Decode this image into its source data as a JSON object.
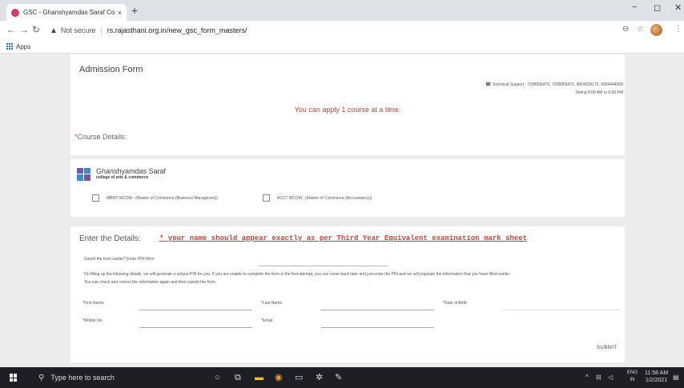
{
  "browser": {
    "tab_title": "GSC - Ghanshyamdas Saraf Colle",
    "tab_close": "×",
    "new_tab": "+",
    "win_minimize": "−",
    "win_restore": "◻",
    "win_close": "✕",
    "security": "Not secure",
    "url": "rs.rajasthani.org.in/new_gsc_form_masters/",
    "bookmark_apps": "Apps",
    "icons": [
      "back-icon",
      "forward-icon",
      "reload-icon",
      "warning-icon",
      "zoom-icon",
      "star-icon",
      "profile-avatar",
      "menu-icon"
    ]
  },
  "admission": {
    "title": "Admission Form",
    "support_line": "Technical Support : 7208955470, 7208955471, 9004028170, 9004444068",
    "timing": "Timing 8:00 AM to 6:00 PM",
    "apply_note": "You can apply 1 course at a time.",
    "course_label": "Course Details:",
    "required_mark": "*"
  },
  "college": {
    "name": "Ghanshyamdas Saraf",
    "subtitle": "college of arts & commerce",
    "courses": [
      {
        "label": "MBMT MCOM - (Master of Commerce (Business Managment))",
        "checked": false
      },
      {
        "label": "ACCT MCOM - (Master of Commerce (Accountancy))",
        "checked": false
      }
    ]
  },
  "details": {
    "heading": "Enter the Details:",
    "warning": "* your name should appear exactly as per Third Year Equivalent examination mark sheet",
    "pin_label": "Saved the form earlier? Enter PIN Here:",
    "desc_line1": "On filling up the following details, we will generate a unique PIN for you. If you are unable to complete the form in the first attempt, you can come back later and just enter the PIN and we will populate the information that you have filled earlier.",
    "desc_line2": "You can check and correct the information again and then submit the form.",
    "fields": {
      "first_name": "*First Name",
      "last_name": "*Last Name",
      "dob": "*Date of Birth",
      "mobile": "*Mobile No.",
      "email": "*Email"
    },
    "submit": "SUBMIT"
  },
  "taskbar": {
    "search_placeholder": "Type here to search",
    "lang_top": "ENG",
    "lang_bottom": "IN",
    "time": "11:58 AM",
    "date": "1/2/2021"
  },
  "colors": {
    "accent_red": "#e53935",
    "taskbar": "#1d1f25",
    "page_bg": "#ececec"
  }
}
